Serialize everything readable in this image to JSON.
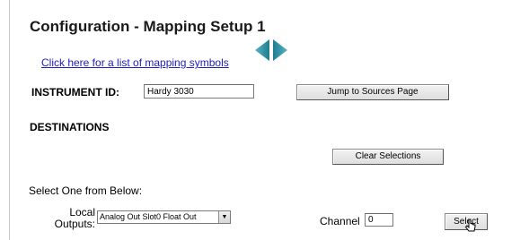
{
  "header": {
    "title": "Configuration - Mapping Setup 1",
    "symbols_link": "Click here for a list of mapping symbols"
  },
  "nav": {
    "prev_icon": "triangle-left-icon",
    "next_icon": "triangle-right-icon",
    "arrow_color": "#2f8fa0"
  },
  "instrument": {
    "label": "INSTRUMENT ID:",
    "value": "Hardy 3030"
  },
  "buttons": {
    "jump": "Jump to Sources Page",
    "clear": "Clear Selections",
    "select": "Select"
  },
  "destinations": {
    "heading": "DESTINATIONS",
    "instruction": "Select One from Below:",
    "local_label_line1": "Local",
    "local_label_line2": "Outputs:",
    "local_selected": "Analog Out Slot0 Float Out",
    "channel_label": "Channel",
    "channel_value": "0"
  }
}
